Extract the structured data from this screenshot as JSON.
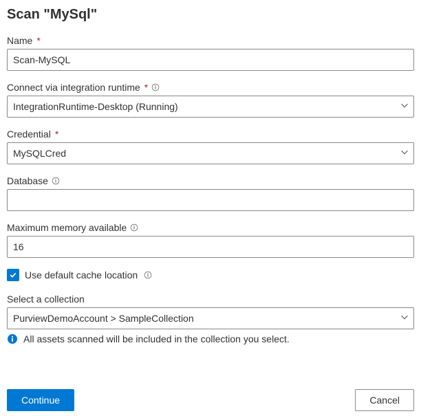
{
  "title": "Scan \"MySql\"",
  "fields": {
    "name": {
      "label": "Name",
      "required": true,
      "value": "Scan-MySQL"
    },
    "runtime": {
      "label": "Connect via integration runtime",
      "required": true,
      "info": true,
      "value": "IntegrationRuntime-Desktop (Running)"
    },
    "credential": {
      "label": "Credential",
      "required": true,
      "value": "MySQLCred"
    },
    "database": {
      "label": "Database",
      "info": true,
      "value": ""
    },
    "memory": {
      "label": "Maximum memory available",
      "info": true,
      "value": "16"
    },
    "cache": {
      "label": "Use default cache location",
      "info": true,
      "checked": true
    },
    "collection": {
      "label": "Select a collection",
      "value": "PurviewDemoAccount > SampleCollection",
      "hint": "All assets scanned will be included in the collection you select."
    }
  },
  "footer": {
    "continue": "Continue",
    "cancel": "Cancel"
  },
  "glyphs": {
    "required": "*"
  }
}
